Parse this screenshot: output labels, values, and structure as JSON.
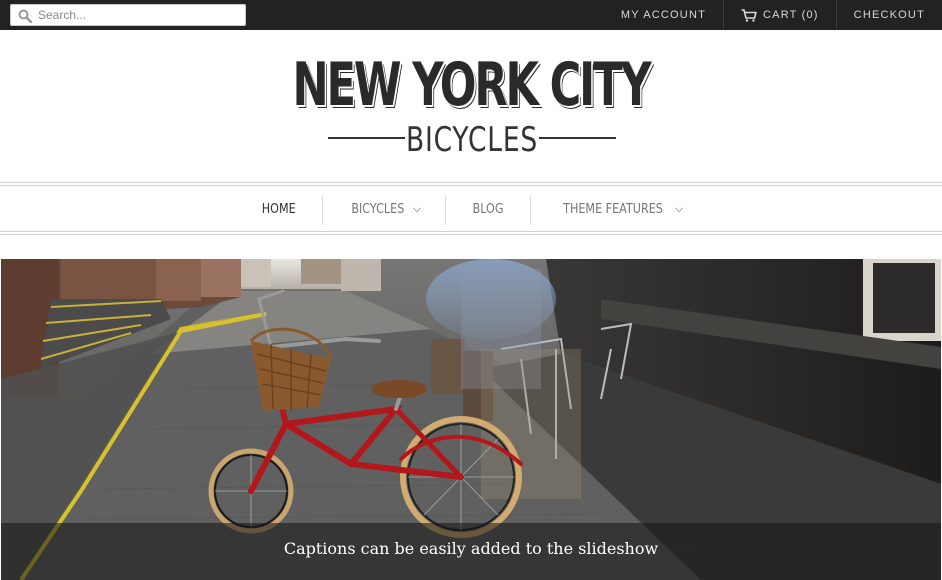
{
  "search": {
    "placeholder": "Search..."
  },
  "topnav": {
    "my_account": "MY ACCOUNT",
    "cart": "CART (0)",
    "checkout": "CHECKOUT"
  },
  "logo": {
    "title": "NEW YORK CITY",
    "subtitle": "BICYCLES"
  },
  "nav": {
    "items": [
      {
        "label": "HOME",
        "has_dropdown": false,
        "active": true
      },
      {
        "label": "BICYCLES",
        "has_dropdown": true,
        "active": false
      },
      {
        "label": "BLOG",
        "has_dropdown": false,
        "active": false
      },
      {
        "label": "THEME FEATURES",
        "has_dropdown": true,
        "active": false
      }
    ]
  },
  "slideshow": {
    "caption": "Captions can be easily added to the slideshow"
  },
  "icons": {
    "search": "search-icon",
    "cart": "cart-icon",
    "dropdown": "chevron-down-icon"
  },
  "colors": {
    "topbar": "#222222",
    "bike": "#b3161b",
    "caption_bg": "rgba(20,20,20,0.55)"
  }
}
